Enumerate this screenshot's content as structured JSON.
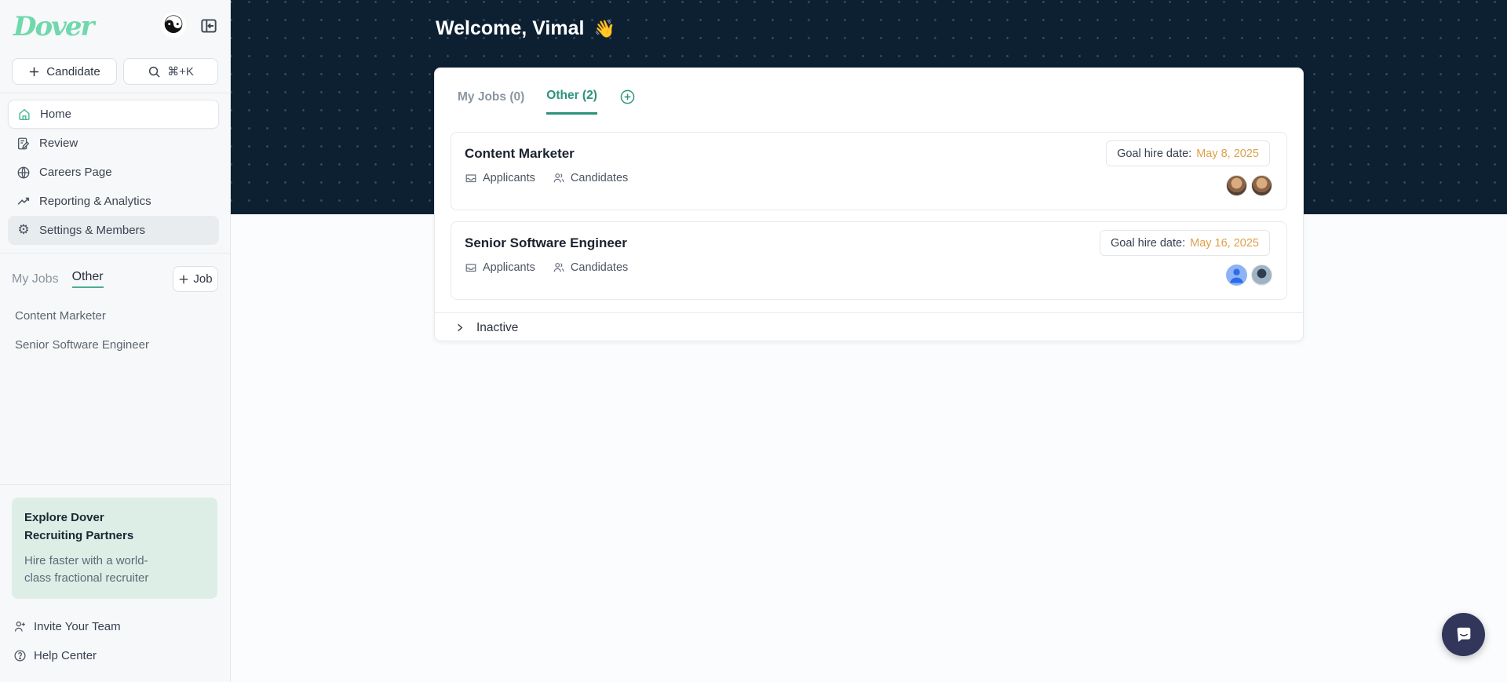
{
  "sidebar": {
    "logo": "Dover",
    "candidate_button": "Candidate",
    "search_shortcut": "⌘+K",
    "nav": [
      {
        "label": "Home",
        "icon": "home-icon",
        "state": "active"
      },
      {
        "label": "Review",
        "icon": "review-icon",
        "state": "default"
      },
      {
        "label": "Careers Page",
        "icon": "globe-icon",
        "state": "default"
      },
      {
        "label": "Reporting & Analytics",
        "icon": "trending-up-icon",
        "state": "default"
      },
      {
        "label": "Settings & Members",
        "icon": "gear-icon",
        "state": "selected"
      }
    ],
    "jobs_header": {
      "my_jobs": "My Jobs",
      "other": "Other",
      "add_job": "Job"
    },
    "job_links": [
      "Content Marketer",
      "Senior Software Engineer"
    ],
    "promo": {
      "title": "Explore Dover Recruiting Partners",
      "subtitle": "Hire faster with a world-class fractional recruiter"
    },
    "invite_label": "Invite Your Team",
    "help_label": "Help Center"
  },
  "header": {
    "welcome": "Welcome, Vimal",
    "wave": "👋"
  },
  "main": {
    "tabs": [
      {
        "label": "My Jobs (0)",
        "active": false
      },
      {
        "label": "Other (2)",
        "active": true
      }
    ],
    "jobs": [
      {
        "title": "Content Marketer",
        "applicants_label": "Applicants",
        "candidates_label": "Candidates",
        "goal_label": "Goal hire date:",
        "goal_date": "May 8, 2025",
        "avatars": [
          "photo-avatar",
          "photo-avatar"
        ]
      },
      {
        "title": "Senior Software Engineer",
        "applicants_label": "Applicants",
        "candidates_label": "Candidates",
        "goal_label": "Goal hire date:",
        "goal_date": "May 16, 2025",
        "avatars": [
          "generic-user-avatar",
          "photo-avatar"
        ]
      }
    ],
    "inactive_label": "Inactive"
  },
  "colors": {
    "brand_green": "#6fd8ac",
    "accent_teal": "#2c927b",
    "underline_green": "#4cae8f",
    "goal_date_amber": "#dca14b",
    "hero_navy": "#0d2032",
    "sidebar_bg": "#f7f8f9",
    "promo_mint": "#ddeee6",
    "chat_navy": "#31365a"
  }
}
